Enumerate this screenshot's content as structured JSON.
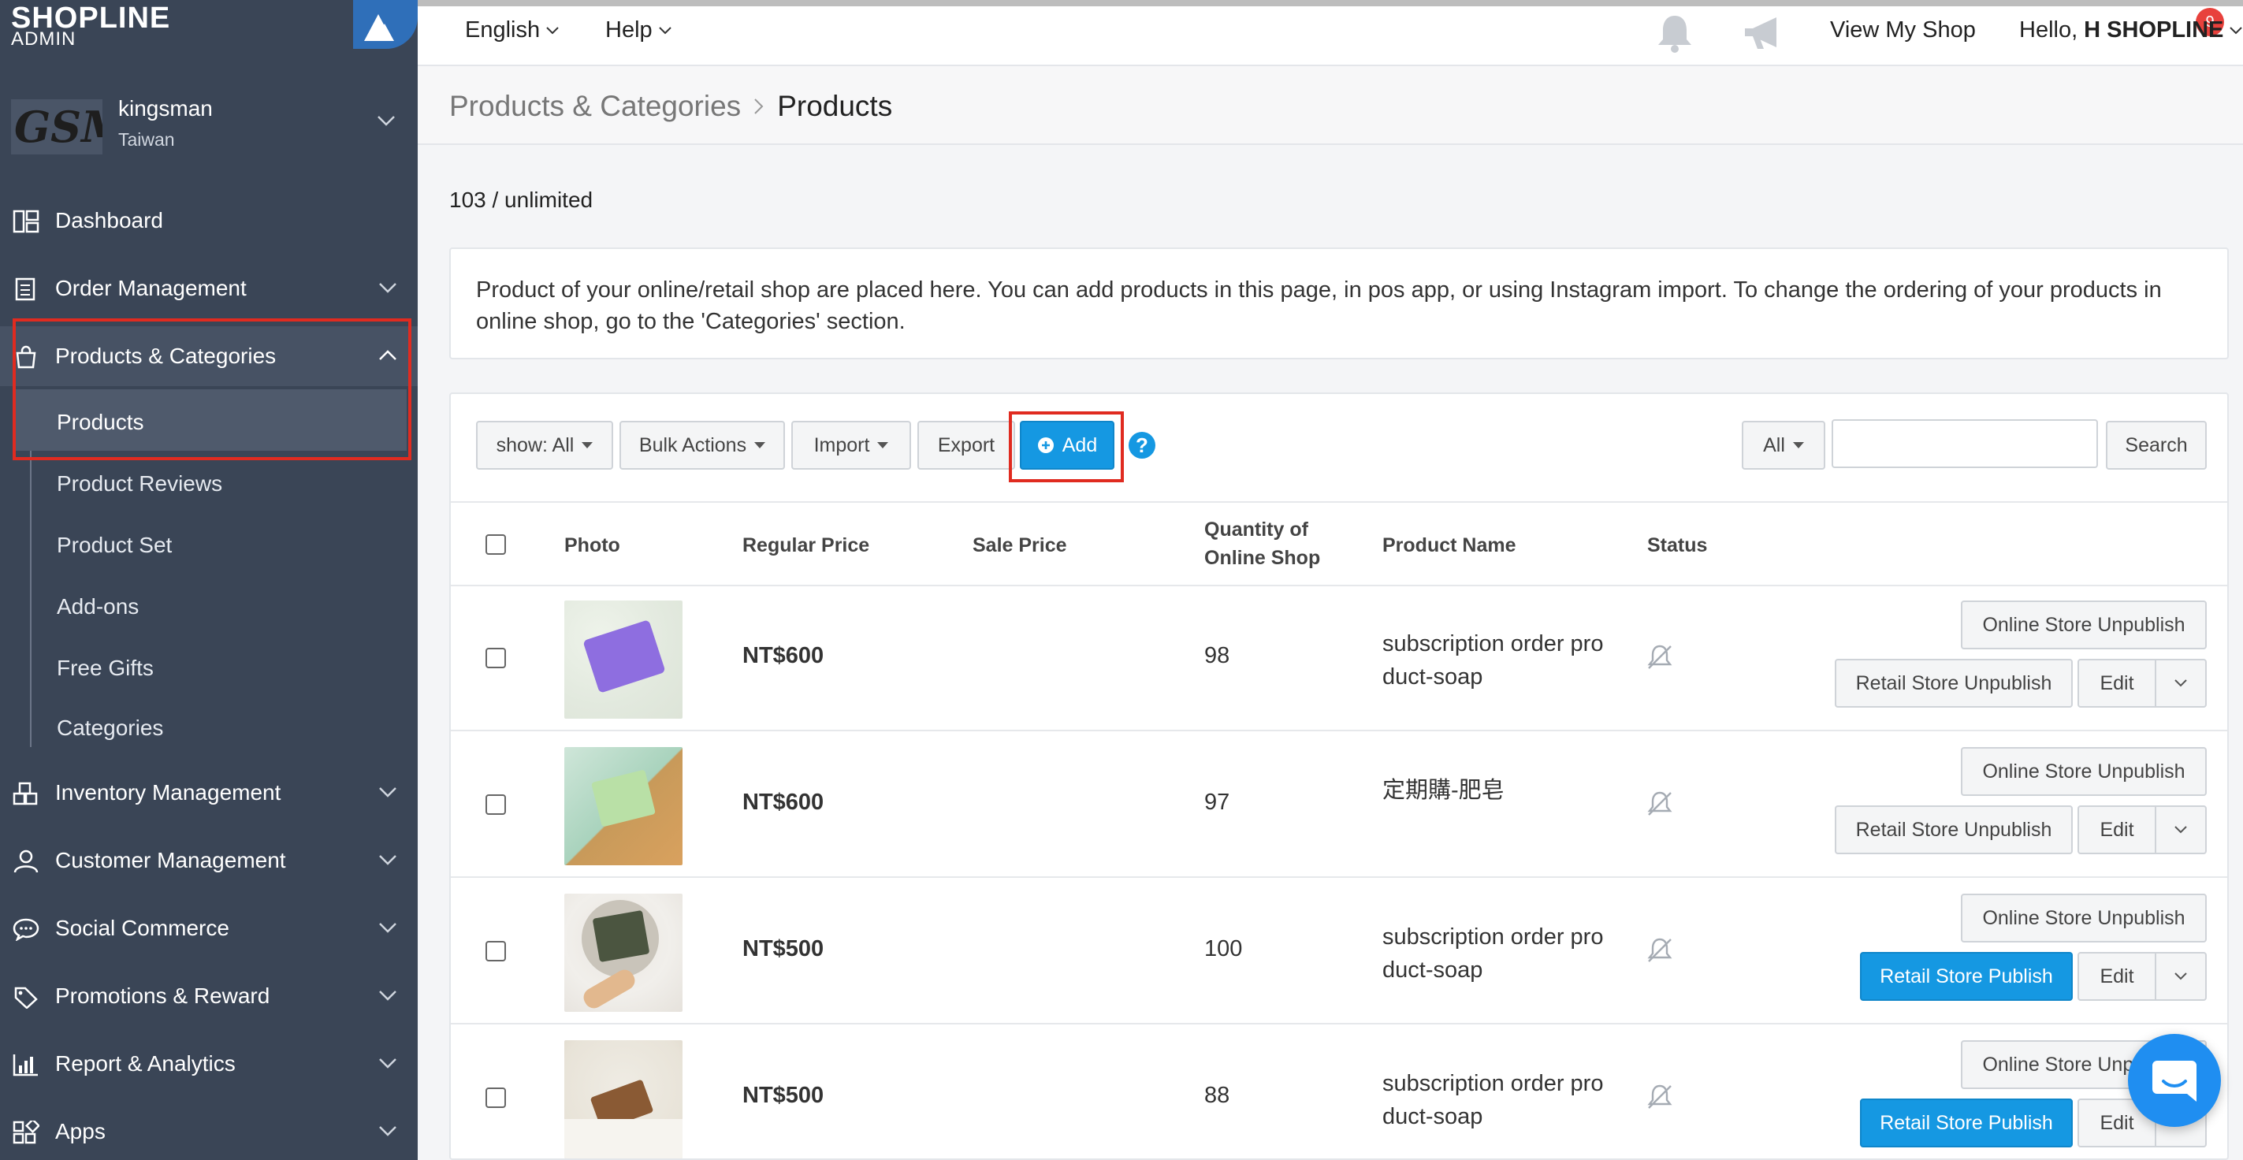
{
  "brand": {
    "name": "SHOPLINE",
    "sub": "ADMIN"
  },
  "shop": {
    "logo_text": "GSM",
    "name": "kingsman",
    "region": "Taiwan"
  },
  "sidebar": {
    "items": [
      {
        "label": "Dashboard",
        "icon": "dashboard-icon"
      },
      {
        "label": "Order Management",
        "icon": "clipboard-icon"
      },
      {
        "label": "Products & Categories",
        "icon": "shopping-bag-icon"
      },
      {
        "label": "Inventory Management",
        "icon": "boxes-icon"
      },
      {
        "label": "Customer Management",
        "icon": "user-icon"
      },
      {
        "label": "Social Commerce",
        "icon": "chat-icon"
      },
      {
        "label": "Promotions & Reward",
        "icon": "tag-icon"
      },
      {
        "label": "Report & Analytics",
        "icon": "bar-chart-icon"
      },
      {
        "label": "Apps",
        "icon": "apps-grid-icon"
      }
    ],
    "subitems": [
      "Products",
      "Product Reviews",
      "Product Set",
      "Add-ons",
      "Free Gifts",
      "Categories"
    ]
  },
  "topbar": {
    "language": "English",
    "help": "Help",
    "notification_count": "9",
    "view_shop": "View My Shop",
    "greeting": "Hello,",
    "user": "H SHOPLINE"
  },
  "breadcrumb": {
    "parent": "Products & Categories",
    "current": "Products"
  },
  "count_text": "103 / unlimited",
  "info_text": "Product of your online/retail shop are placed here. You can add products in this page, in pos app, or using Instagram import. To change the ordering of your products in online shop, go to the 'Categories' section.",
  "toolbar": {
    "show": "show: All",
    "bulk": "Bulk Actions",
    "import": "Import",
    "export": "Export",
    "add": "Add",
    "filter": "All",
    "search_placeholder": "",
    "search": "Search"
  },
  "table": {
    "headers": {
      "photo": "Photo",
      "regular_price": "Regular Price",
      "sale_price": "Sale Price",
      "qty_line1": "Quantity of",
      "qty_line2": "Online Shop",
      "name": "Product Name",
      "status": "Status"
    },
    "rows": [
      {
        "price": "NT$600",
        "qty": "98",
        "name": "subscription order product-soap",
        "online_btn": "Online Store Unpublish",
        "retail_btn": "Retail Store Unpublish",
        "retail_published": true,
        "edit": "Edit"
      },
      {
        "price": "NT$600",
        "qty": "97",
        "name": "定期購-肥皂",
        "online_btn": "Online Store Unpublish",
        "retail_btn": "Retail Store Unpublish",
        "retail_published": true,
        "edit": "Edit"
      },
      {
        "price": "NT$500",
        "qty": "100",
        "name": "subscription order product-soap",
        "online_btn": "Online Store Unpublish",
        "retail_btn": "Retail Store Publish",
        "retail_published": false,
        "edit": "Edit"
      },
      {
        "price": "NT$500",
        "qty": "88",
        "name": "subscription order product-soap",
        "online_btn": "Online Store Unpublish",
        "retail_btn": "Retail Store Publish",
        "retail_published": false,
        "edit": "Edit"
      }
    ]
  },
  "colors": {
    "sidebar": "#3a4556",
    "primary": "#1598e2",
    "highlight": "#e02b20",
    "badge": "#e8413c"
  }
}
